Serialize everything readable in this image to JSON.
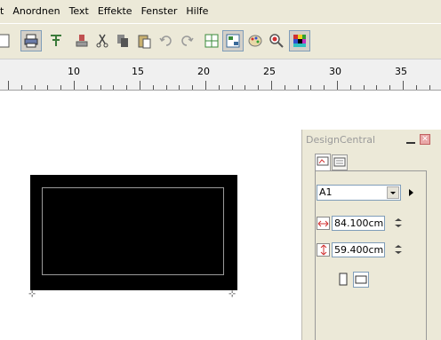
{
  "menubar": {
    "items": [
      "t",
      "Anordnen",
      "Text",
      "Effekte",
      "Fenster",
      "Hilfe"
    ]
  },
  "toolbar": {
    "buttons": [
      "page-icon",
      "print-icon",
      "print-setup-icon",
      "stamp-icon",
      "cut-icon",
      "copy-icon",
      "paste-icon",
      "undo-icon",
      "redo-icon",
      "layout-icon",
      "layout-alt-icon",
      "palette-icon",
      "zoom-icon",
      "color-grid-icon"
    ]
  },
  "ruler": {
    "labels": [
      "10",
      "15",
      "20",
      "25",
      "30",
      "35"
    ]
  },
  "panel": {
    "title": "DesignCentral",
    "format_value": "A1",
    "width_value": "84.100cm",
    "height_value": "59.400cm"
  },
  "colors": {
    "chrome": "#ece9d8",
    "page": "#000000",
    "accent_red": "#d03030"
  }
}
